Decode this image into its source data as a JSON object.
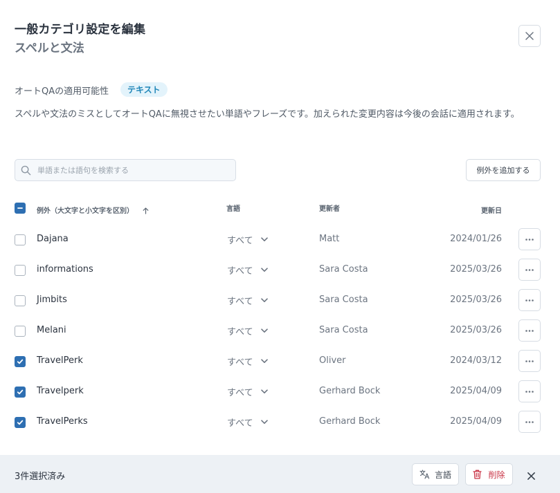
{
  "header": {
    "title": "一般カテゴリ設定を編集",
    "subtitle": "スペルと文法"
  },
  "applicability": {
    "label": "オートQAの適用可能性",
    "tag": "テキスト"
  },
  "description": "スペルや文法のミスとしてオートQAに無視させたい単語やフレーズです。加えられた変更内容は今後の会話に適用されます。",
  "search": {
    "placeholder": "単語または語句を検索する",
    "value": ""
  },
  "add_button_label": "例外を追加する",
  "table": {
    "columns": {
      "exception": "例外（大文字と小文字を区別）",
      "language": "言語",
      "updated_by": "更新者",
      "updated_on": "更新日"
    },
    "select_all_state": "indeterminate",
    "rows": [
      {
        "name": "Dajana",
        "language": "すべて",
        "updated_by": "Matt",
        "date": "2024/01/26",
        "checked": false
      },
      {
        "name": "informations",
        "language": "すべて",
        "updated_by": "Sara Costa",
        "date": "2025/03/26",
        "checked": false
      },
      {
        "name": "Jimbits",
        "language": "すべて",
        "updated_by": "Sara Costa",
        "date": "2025/03/26",
        "checked": false
      },
      {
        "name": "Melani",
        "language": "すべて",
        "updated_by": "Sara Costa",
        "date": "2025/03/26",
        "checked": false
      },
      {
        "name": "TravelPerk",
        "language": "すべて",
        "updated_by": "Oliver",
        "date": "2024/03/12",
        "checked": true
      },
      {
        "name": "Travelperk",
        "language": "すべて",
        "updated_by": "Gerhard Bock",
        "date": "2025/04/09",
        "checked": true
      },
      {
        "name": "TravelPerks",
        "language": "すべて",
        "updated_by": "Gerhard Bock",
        "date": "2025/04/09",
        "checked": true
      }
    ]
  },
  "footer": {
    "selected_count": "3件選択済み",
    "language_button": "言語",
    "delete_button": "削除"
  },
  "colors": {
    "accent": "#2e6fb2",
    "danger": "#c93446",
    "tag_bg": "#e3f3fb",
    "tag_text": "#1f86b8",
    "footer_bg": "#edf1f5"
  }
}
